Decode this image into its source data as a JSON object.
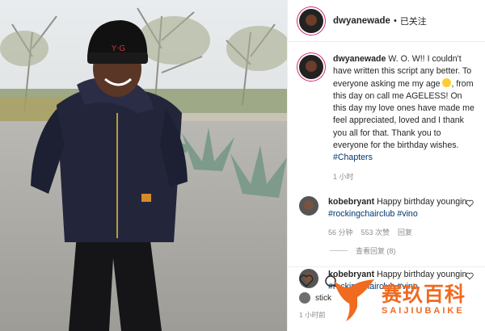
{
  "post": {
    "author": "dwyanewade",
    "follow_status": "已关注",
    "caption_text": "W. O. W!! I couldn't have written this script any better. To everyone asking me my age",
    "caption_text_2": ", from this day on call me AGELESS! On this day my love ones have made me feel appreciated, loved and I thank you all for that. Thank you to everyone for the birthday wishes. ",
    "caption_tag": "#Chapters",
    "caption_time": "1 小时"
  },
  "comments": [
    {
      "user": "kobebryant",
      "text": "Happy birthday youngin ",
      "tags": "#rockingchairclub #vino",
      "time": "56 分钟",
      "likes": "553 次赞",
      "reply": "回复",
      "view_replies": "查看回复 (8)"
    },
    {
      "user": "kobebryant",
      "text": "Happy birthday youngin ",
      "tags": "#rockingchairclub #vino"
    }
  ],
  "footer": {
    "likers_prefix": "stick",
    "time": "1 小时前"
  },
  "watermark": {
    "cn": "赛玖百科",
    "en": "SAIJIUBAIKE"
  },
  "colors": {
    "accent": "#f06a1f",
    "hashtag": "#00376b",
    "meta": "#8e8e8e"
  }
}
